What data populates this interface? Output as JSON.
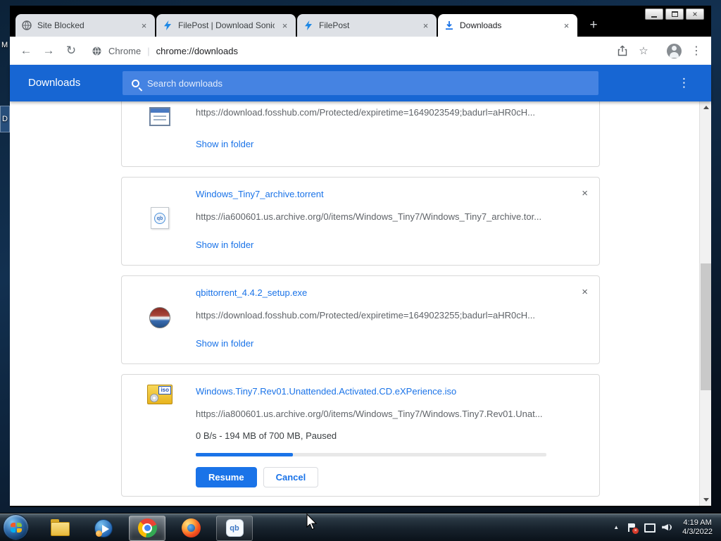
{
  "desktop": {
    "icon_labels": [
      "M",
      "D"
    ]
  },
  "browser": {
    "tabs": [
      {
        "title": "Site Blocked"
      },
      {
        "title": "FilePost | Download Sonic"
      },
      {
        "title": "FilePost"
      },
      {
        "title": "Downloads"
      }
    ],
    "omnibox": {
      "site_name": "Chrome",
      "separator": "|",
      "url": "chrome://downloads"
    }
  },
  "downloads_page": {
    "title": "Downloads",
    "search_placeholder": "Search downloads",
    "items": [
      {
        "url": "https://download.fosshub.com/Protected/expiretime=1649023549;badurl=aHR0cH...",
        "show_in_folder": "Show in folder"
      },
      {
        "name": "Windows_Tiny7_archive.torrent",
        "url": "https://ia600601.us.archive.org/0/items/Windows_Tiny7/Windows_Tiny7_archive.tor...",
        "show_in_folder": "Show in folder"
      },
      {
        "name": "qbittorrent_4.4.2_setup.exe",
        "url": "https://download.fosshub.com/Protected/expiretime=1649023255;badurl=aHR0cH...",
        "show_in_folder": "Show in folder"
      },
      {
        "name": "Windows.Tiny7.Rev01.Unattended.Activated.CD.eXPerience.iso",
        "url": "https://ia800601.us.archive.org/0/items/Windows_Tiny7/Windows.Tiny7.Rev01.Unat...",
        "status": "0 B/s - 194 MB of 700 MB, Paused",
        "progress_percent": 27.7,
        "resume_label": "Resume",
        "cancel_label": "Cancel"
      }
    ]
  },
  "taskbar": {
    "clock_time": "4:19 AM",
    "clock_date": "4/3/2022"
  },
  "glyphs": {
    "close": "×",
    "plus": "+",
    "menu_dots": "⋮",
    "back": "←",
    "forward": "→",
    "reload": "↻",
    "star": "☆",
    "tray_expand": "▲",
    "error_badge": "×",
    "qb_logo": "qb"
  },
  "colors": {
    "header_blue": "#1766d3",
    "search_field_blue": "#4583e2",
    "accent_blue": "#1a73e8",
    "inactive_tab": "#dee1e6",
    "url_gray": "#5f6368"
  }
}
